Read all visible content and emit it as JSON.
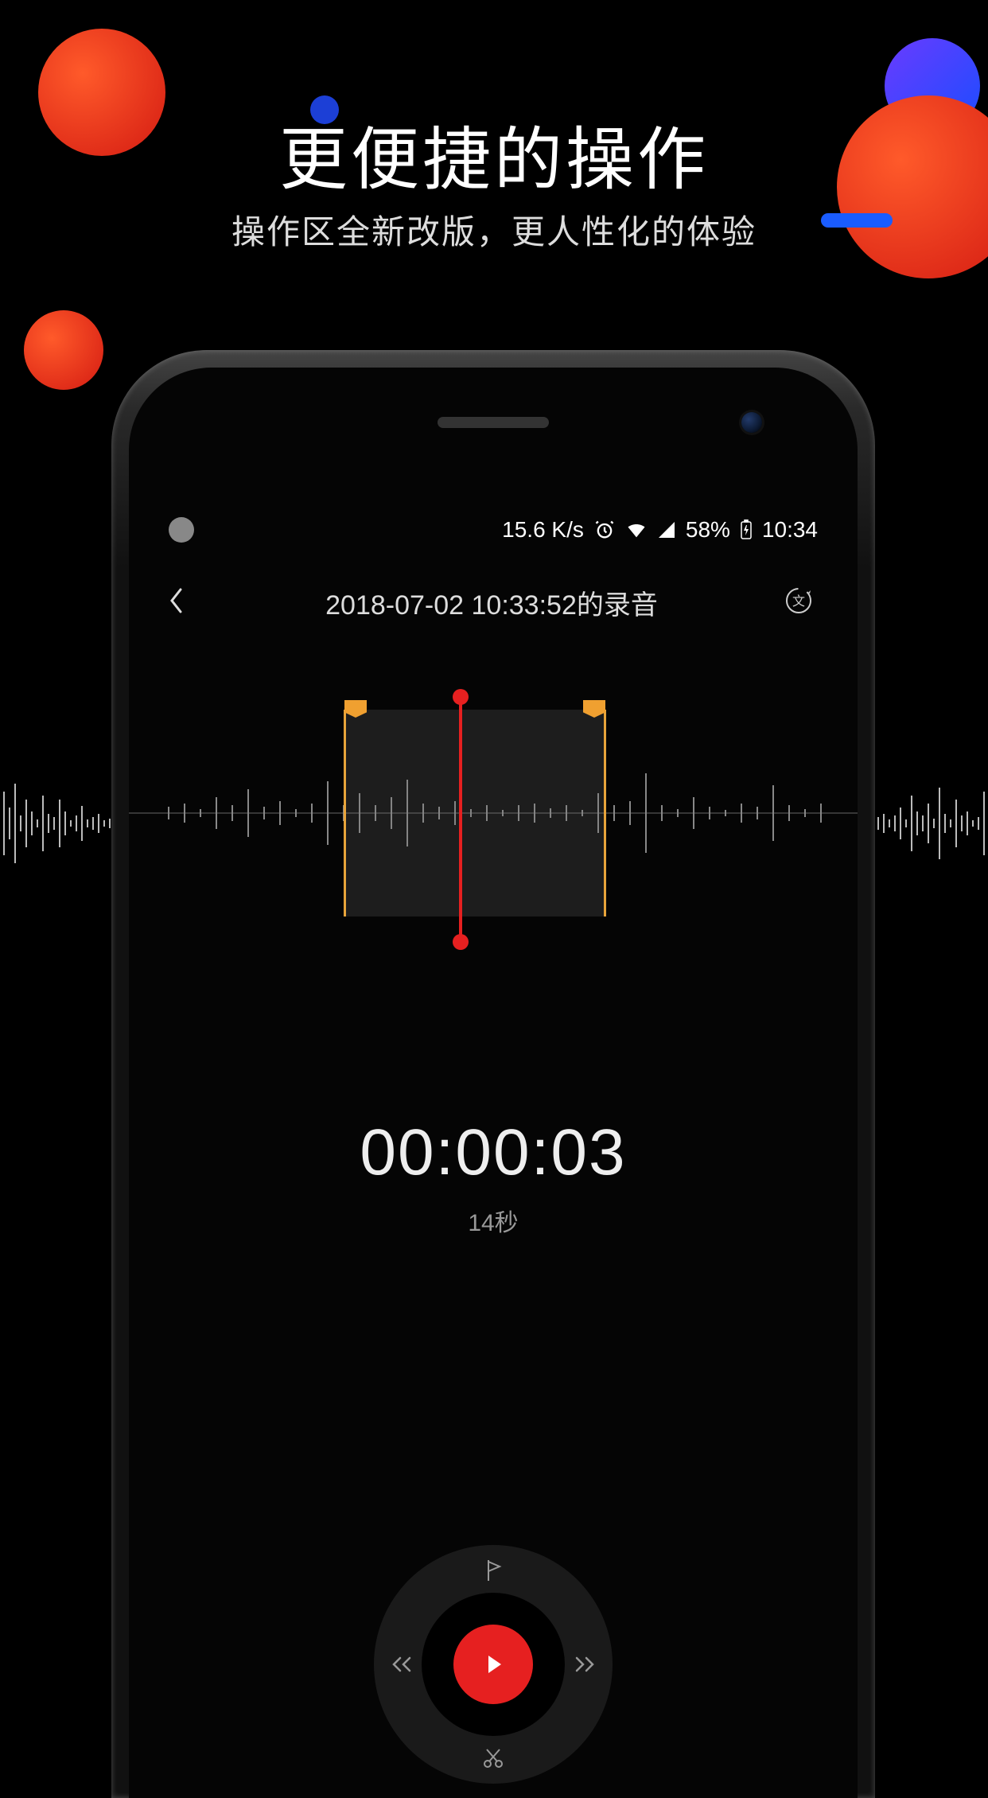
{
  "promo": {
    "title": "更便捷的操作",
    "subtitle": "操作区全新改版，更人性化的体验"
  },
  "status": {
    "net_speed": "15.6 K/s",
    "battery_pct": "58%",
    "time": "10:34"
  },
  "header": {
    "title": "2018-07-02 10:33:52的录音"
  },
  "playback": {
    "elapsed": "00:00:03",
    "total_label": "14秒"
  },
  "colors": {
    "accent_red": "#e62020",
    "marker_orange": "#f0a030",
    "blue": "#1a5cff"
  }
}
